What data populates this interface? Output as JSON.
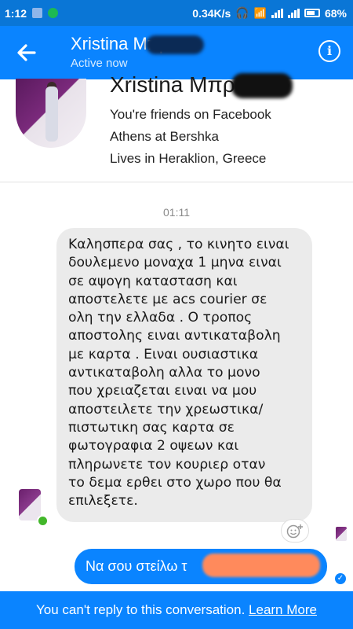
{
  "status_bar": {
    "time": "1:12",
    "net_speed": "0.34K/s",
    "battery": "68%"
  },
  "header": {
    "name": "Xristina Μπρ",
    "status": "Active now",
    "back_icon": "back-arrow-icon",
    "info_icon": "info-icon"
  },
  "profile": {
    "name": "Xristina Μπρ",
    "friends_line": "You're friends on Facebook",
    "work_line": "Athens at Bershka",
    "lives_line": "Lives in Heraklion, Greece"
  },
  "conversation": {
    "timestamp": "01:11",
    "incoming_message": "Καλησπερα σας , το κινητο ειναι\nδουλεμενο μοναχα 1 μηνα ειναι\nσε αψογη κατασταση και\nαποστελετε με acs courier σε\nολη την ελλαδα . Ο τροπος\nαποστολης ειναι αντικαταβολη\nμε καρτα . Ειναι ουσιαστικα\nαντικαταβολη αλλα το μονο\nπου χρειαζεται ειναι να μου\nαποστειλετε την χρεωστικα/\nπιστωτικη σας καρτα σε\nφωτογραφια 2 οψεων και\nπληρωνετε τον κουριερ οταν\nτο δεμα ερθει στο χωρο που θα\nεπιλεξετε.",
    "outgoing_message": "Να σου στείλω τ"
  },
  "footer": {
    "text": "You can't reply to this conversation.",
    "link": "Learn More"
  },
  "colors": {
    "messenger_blue": "#0a84ff",
    "status_bar": "#0a76d6",
    "bubble_gray": "#ebebeb"
  }
}
